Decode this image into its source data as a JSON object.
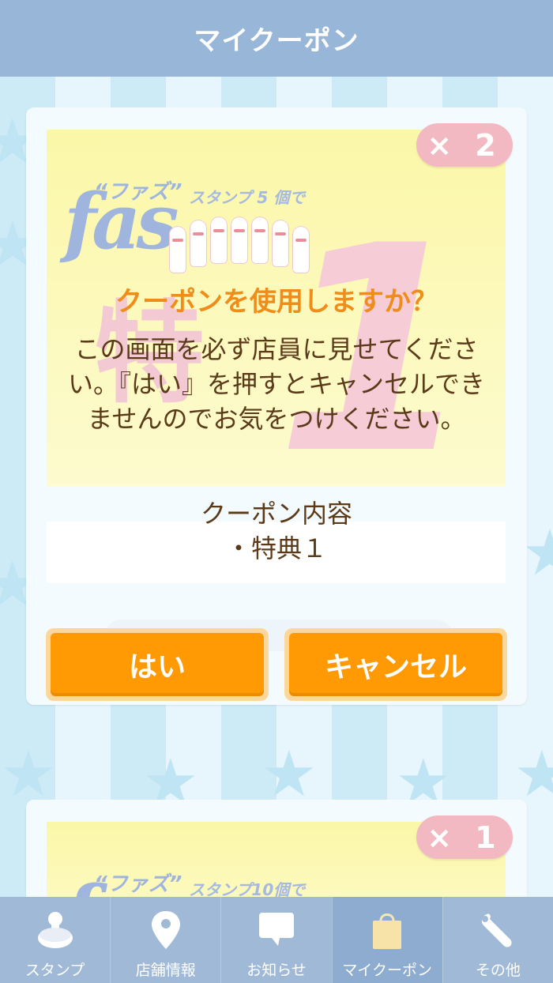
{
  "header": {
    "title": "マイクーポン"
  },
  "coupons": [
    {
      "count_badge": "× 2",
      "logo_text": "fas",
      "logo_sub": "“ファズ”",
      "stamp_text": "スタンプ 5 個で",
      "big_char": "1",
      "toku_char": "特"
    },
    {
      "count_badge": "× 1",
      "logo_text": "fas",
      "logo_sub": "“ファズ”",
      "stamp_text": "スタンプ10個で",
      "big_char": "",
      "toku_char": ""
    }
  ],
  "dialog": {
    "title": "クーポンを使用しますか？",
    "message": "この画面を必ず店員に見せてください。『はい』を押すとキャンセルできませんのでお気をつけください。",
    "content_label": "クーポン内容",
    "content_item": "・特典１",
    "yes_label": "はい",
    "cancel_label": "キャンセル"
  },
  "tabs": [
    {
      "label": "スタンプ",
      "icon": "stamp-icon",
      "active": false
    },
    {
      "label": "店舗情報",
      "icon": "map-pin-icon",
      "active": false
    },
    {
      "label": "お知らせ",
      "icon": "speech-bubble-icon",
      "active": false
    },
    {
      "label": "マイクーポン",
      "icon": "shopping-bag-icon",
      "active": true
    },
    {
      "label": "その他",
      "icon": "wrench-icon",
      "active": false
    }
  ],
  "colors": {
    "header_bg": "#98b6d8",
    "accent_orange": "#ff9a04",
    "dialog_title": "#f08c1a",
    "text_brown": "#5b3a1a",
    "badge_pink": "#f2b9c2",
    "tabbar_bg": "#a0b9d6"
  }
}
